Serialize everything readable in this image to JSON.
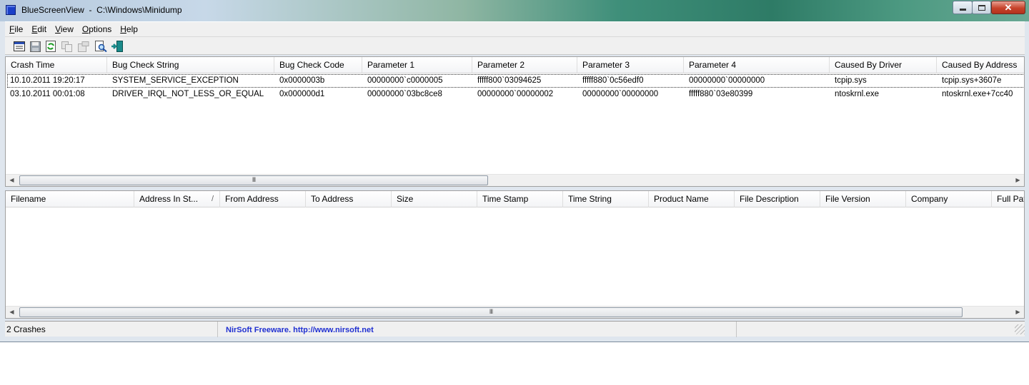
{
  "window": {
    "title": "BlueScreenView  -  C:\\Windows\\Minidump",
    "close_glyph": "✕"
  },
  "menu": [
    {
      "first": "F",
      "rest": "ile"
    },
    {
      "first": "E",
      "rest": "dit"
    },
    {
      "first": "V",
      "rest": "iew"
    },
    {
      "first": "O",
      "rest": "ptions"
    },
    {
      "first": "H",
      "rest": "elp"
    }
  ],
  "toolbar": {
    "icons": [
      "properties-icon",
      "save-icon",
      "refresh-icon",
      "copy-icon",
      "advanced-options-icon",
      "find-icon",
      "exit-icon"
    ]
  },
  "crash_list": {
    "columns": [
      "Crash Time",
      "Bug Check String",
      "Bug Check Code",
      "Parameter 1",
      "Parameter 2",
      "Parameter 3",
      "Parameter 4",
      "Caused By Driver",
      "Caused By Address"
    ],
    "rows": [
      [
        "10.10.2011 19:20:17",
        "SYSTEM_SERVICE_EXCEPTION",
        "0x0000003b",
        "00000000`c0000005",
        "fffff800`03094625",
        "fffff880`0c56edf0",
        "00000000`00000000",
        "tcpip.sys",
        "tcpip.sys+3607e"
      ],
      [
        "03.10.2011 00:01:08",
        "DRIVER_IRQL_NOT_LESS_OR_EQUAL",
        "0x000000d1",
        "00000000`03bc8ce8",
        "00000000`00000002",
        "00000000`00000000",
        "fffff880`03e80399",
        "ntoskrnl.exe",
        "ntoskrnl.exe+7cc40"
      ]
    ]
  },
  "module_list": {
    "columns": [
      "Filename",
      "Address In St...",
      "From Address",
      "To Address",
      "Size",
      "Time Stamp",
      "Time String",
      "Product Name",
      "File Description",
      "File Version",
      "Company",
      "Full Pat"
    ],
    "sort_glyph": "/"
  },
  "scrollbar": {
    "left_arrow": "◀",
    "right_arrow": "▶",
    "grip": "III"
  },
  "status": {
    "count": "2 Crashes",
    "link": "NirSoft Freeware.  http://www.nirsoft.net"
  }
}
